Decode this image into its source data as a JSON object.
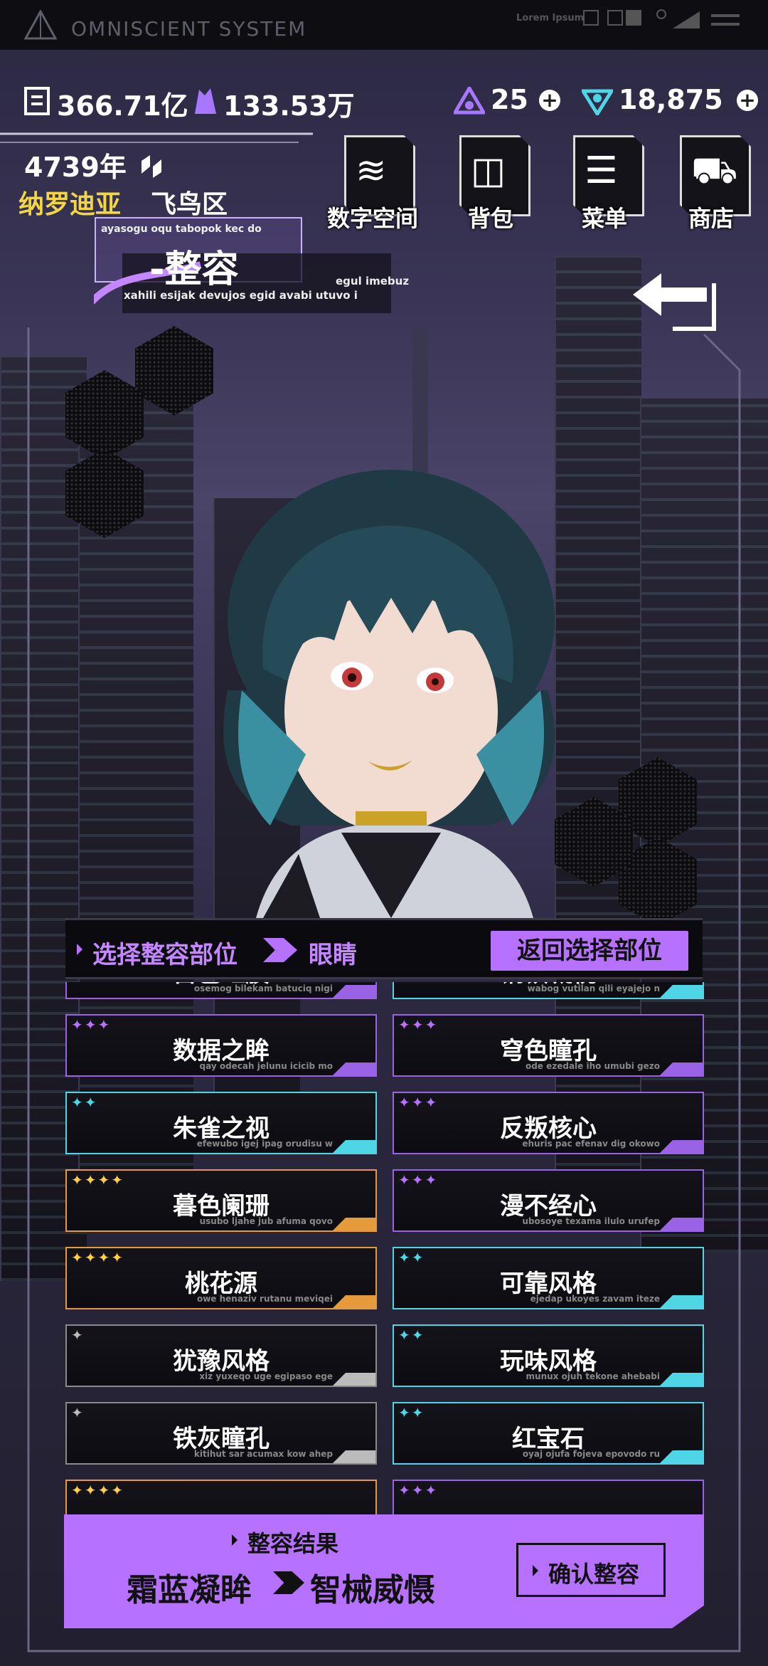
{
  "status_bar": {
    "title": "OMNISCIENT SYSTEM",
    "lorem": "Lorem Ipsum"
  },
  "resources": {
    "currency1": "366.71亿",
    "currency2": "133.53万",
    "energy": "25",
    "gems": "18,875"
  },
  "location": {
    "year": "4739年",
    "city": "纳罗迪亚",
    "district": "飞鸟区"
  },
  "nav": [
    {
      "label": "数字空间",
      "icon": "layers-icon"
    },
    {
      "label": "背包",
      "icon": "bag-icon"
    },
    {
      "label": "菜单",
      "icon": "menu-icon"
    },
    {
      "label": "商店",
      "icon": "cart-icon"
    }
  ],
  "title_block": {
    "small1": "ayasogu oqu tabopok kec do",
    "main": "-整容",
    "small2": "egul imebuz",
    "small3": "xahili esijak devujos egid avabi utuvo i"
  },
  "selection": {
    "label": "选择整容部位",
    "part": "眼睛",
    "return_label": "返回选择部位"
  },
  "items": [
    {
      "name": "古色虹膜",
      "sub": "osemog bilekam batuciq nigi",
      "stars": "",
      "rarity": "purple"
    },
    {
      "name": "钢铁凝视",
      "sub": "wabog vutilan qili eyajejo n",
      "stars": "",
      "rarity": "cyan"
    },
    {
      "name": "数据之眸",
      "sub": "qay odecah jelunu icicib mo",
      "stars": "✦✦✦",
      "rarity": "purple"
    },
    {
      "name": "穹色瞳孔",
      "sub": "ode ezedale iho umubi gezo",
      "stars": "✦✦✦",
      "rarity": "purple"
    },
    {
      "name": "朱雀之视",
      "sub": "efewubo igej ipag orudisu w",
      "stars": "✦✦",
      "rarity": "cyan"
    },
    {
      "name": "反叛核心",
      "sub": "ehuris pac efenav dig okowo",
      "stars": "✦✦✦",
      "rarity": "purple"
    },
    {
      "name": "暮色阑珊",
      "sub": "usubo ljahe jub afuma qovo",
      "stars": "✦✦✦✦",
      "rarity": "orange"
    },
    {
      "name": "漫不经心",
      "sub": "ubosoye texama ilulo urufep",
      "stars": "✦✦✦",
      "rarity": "purple"
    },
    {
      "name": "桃花源",
      "sub": "owe henaziv rutanu meviqei",
      "stars": "✦✦✦✦",
      "rarity": "orange"
    },
    {
      "name": "可靠风格",
      "sub": "ejedap ukoyes zavam iteze",
      "stars": "✦✦",
      "rarity": "cyan"
    },
    {
      "name": "犹豫风格",
      "sub": "xiz yuxeqo uge egipaso ege",
      "stars": "✦",
      "rarity": "gray"
    },
    {
      "name": "玩味风格",
      "sub": "munux ojuh tekone ahebabi",
      "stars": "✦✦",
      "rarity": "cyan"
    },
    {
      "name": "铁灰瞳孔",
      "sub": "kitihut sar acumax kow ahep",
      "stars": "✦",
      "rarity": "gray"
    },
    {
      "name": "红宝石",
      "sub": "oyaj ojufa fojeva epovodo ru",
      "stars": "✦✦",
      "rarity": "cyan"
    },
    {
      "name": "",
      "sub": "",
      "stars": "✦✦✦✦",
      "rarity": "orange"
    },
    {
      "name": "",
      "sub": "",
      "stars": "✦✦✦",
      "rarity": "purple"
    }
  ],
  "result": {
    "label": "整容结果",
    "from": "霜蓝凝眸",
    "to": "智械威慑",
    "confirm_label": "确认整容"
  },
  "colors": {
    "accent": "#b771ff",
    "cyan": "#4fd6e6",
    "orange": "#e59a3c",
    "gold": "#f2d643"
  }
}
